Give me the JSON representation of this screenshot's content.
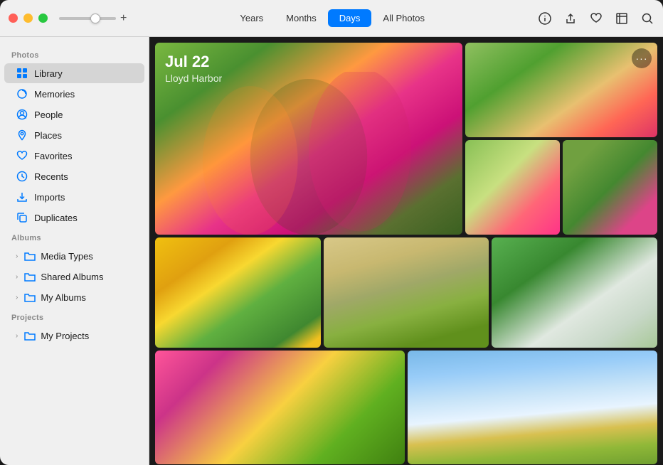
{
  "window": {
    "title": "Photos"
  },
  "titlebar": {
    "traffic_lights": [
      "red",
      "yellow",
      "green"
    ],
    "zoom_plus": "+",
    "tabs": [
      {
        "id": "years",
        "label": "Years",
        "active": false
      },
      {
        "id": "months",
        "label": "Months",
        "active": false
      },
      {
        "id": "days",
        "label": "Days",
        "active": true
      },
      {
        "id": "allphotos",
        "label": "All Photos",
        "active": false
      }
    ]
  },
  "sidebar": {
    "sections": [
      {
        "label": "Photos",
        "items": [
          {
            "id": "library",
            "label": "Library",
            "icon": "photo-grid-icon",
            "active": true
          },
          {
            "id": "memories",
            "label": "Memories",
            "icon": "memories-icon",
            "active": false
          },
          {
            "id": "people",
            "label": "People",
            "icon": "person-circle-icon",
            "active": false
          },
          {
            "id": "places",
            "label": "Places",
            "icon": "location-icon",
            "active": false
          },
          {
            "id": "favorites",
            "label": "Favorites",
            "icon": "heart-icon",
            "active": false
          },
          {
            "id": "recents",
            "label": "Recents",
            "icon": "clock-icon",
            "active": false
          },
          {
            "id": "imports",
            "label": "Imports",
            "icon": "import-icon",
            "active": false
          },
          {
            "id": "duplicates",
            "label": "Duplicates",
            "icon": "duplicate-icon",
            "active": false
          }
        ]
      },
      {
        "label": "Albums",
        "groups": [
          {
            "id": "media-types",
            "label": "Media Types",
            "icon": "folder-icon"
          },
          {
            "id": "shared-albums",
            "label": "Shared Albums",
            "icon": "folder-icon"
          },
          {
            "id": "my-albums",
            "label": "My Albums",
            "icon": "folder-icon"
          }
        ]
      },
      {
        "label": "Projects",
        "groups": [
          {
            "id": "my-projects",
            "label": "My Projects",
            "icon": "folder-icon"
          }
        ]
      }
    ]
  },
  "photo_area": {
    "date_title": "Jul 22",
    "date_subtitle": "Lloyd Harbor",
    "more_button_label": "···"
  },
  "toolbar_icons": [
    {
      "id": "info",
      "symbol": "ⓘ"
    },
    {
      "id": "share",
      "symbol": "⬆"
    },
    {
      "id": "heart",
      "symbol": "♡"
    },
    {
      "id": "crop",
      "symbol": "⊡"
    },
    {
      "id": "search",
      "symbol": "⌕"
    }
  ]
}
